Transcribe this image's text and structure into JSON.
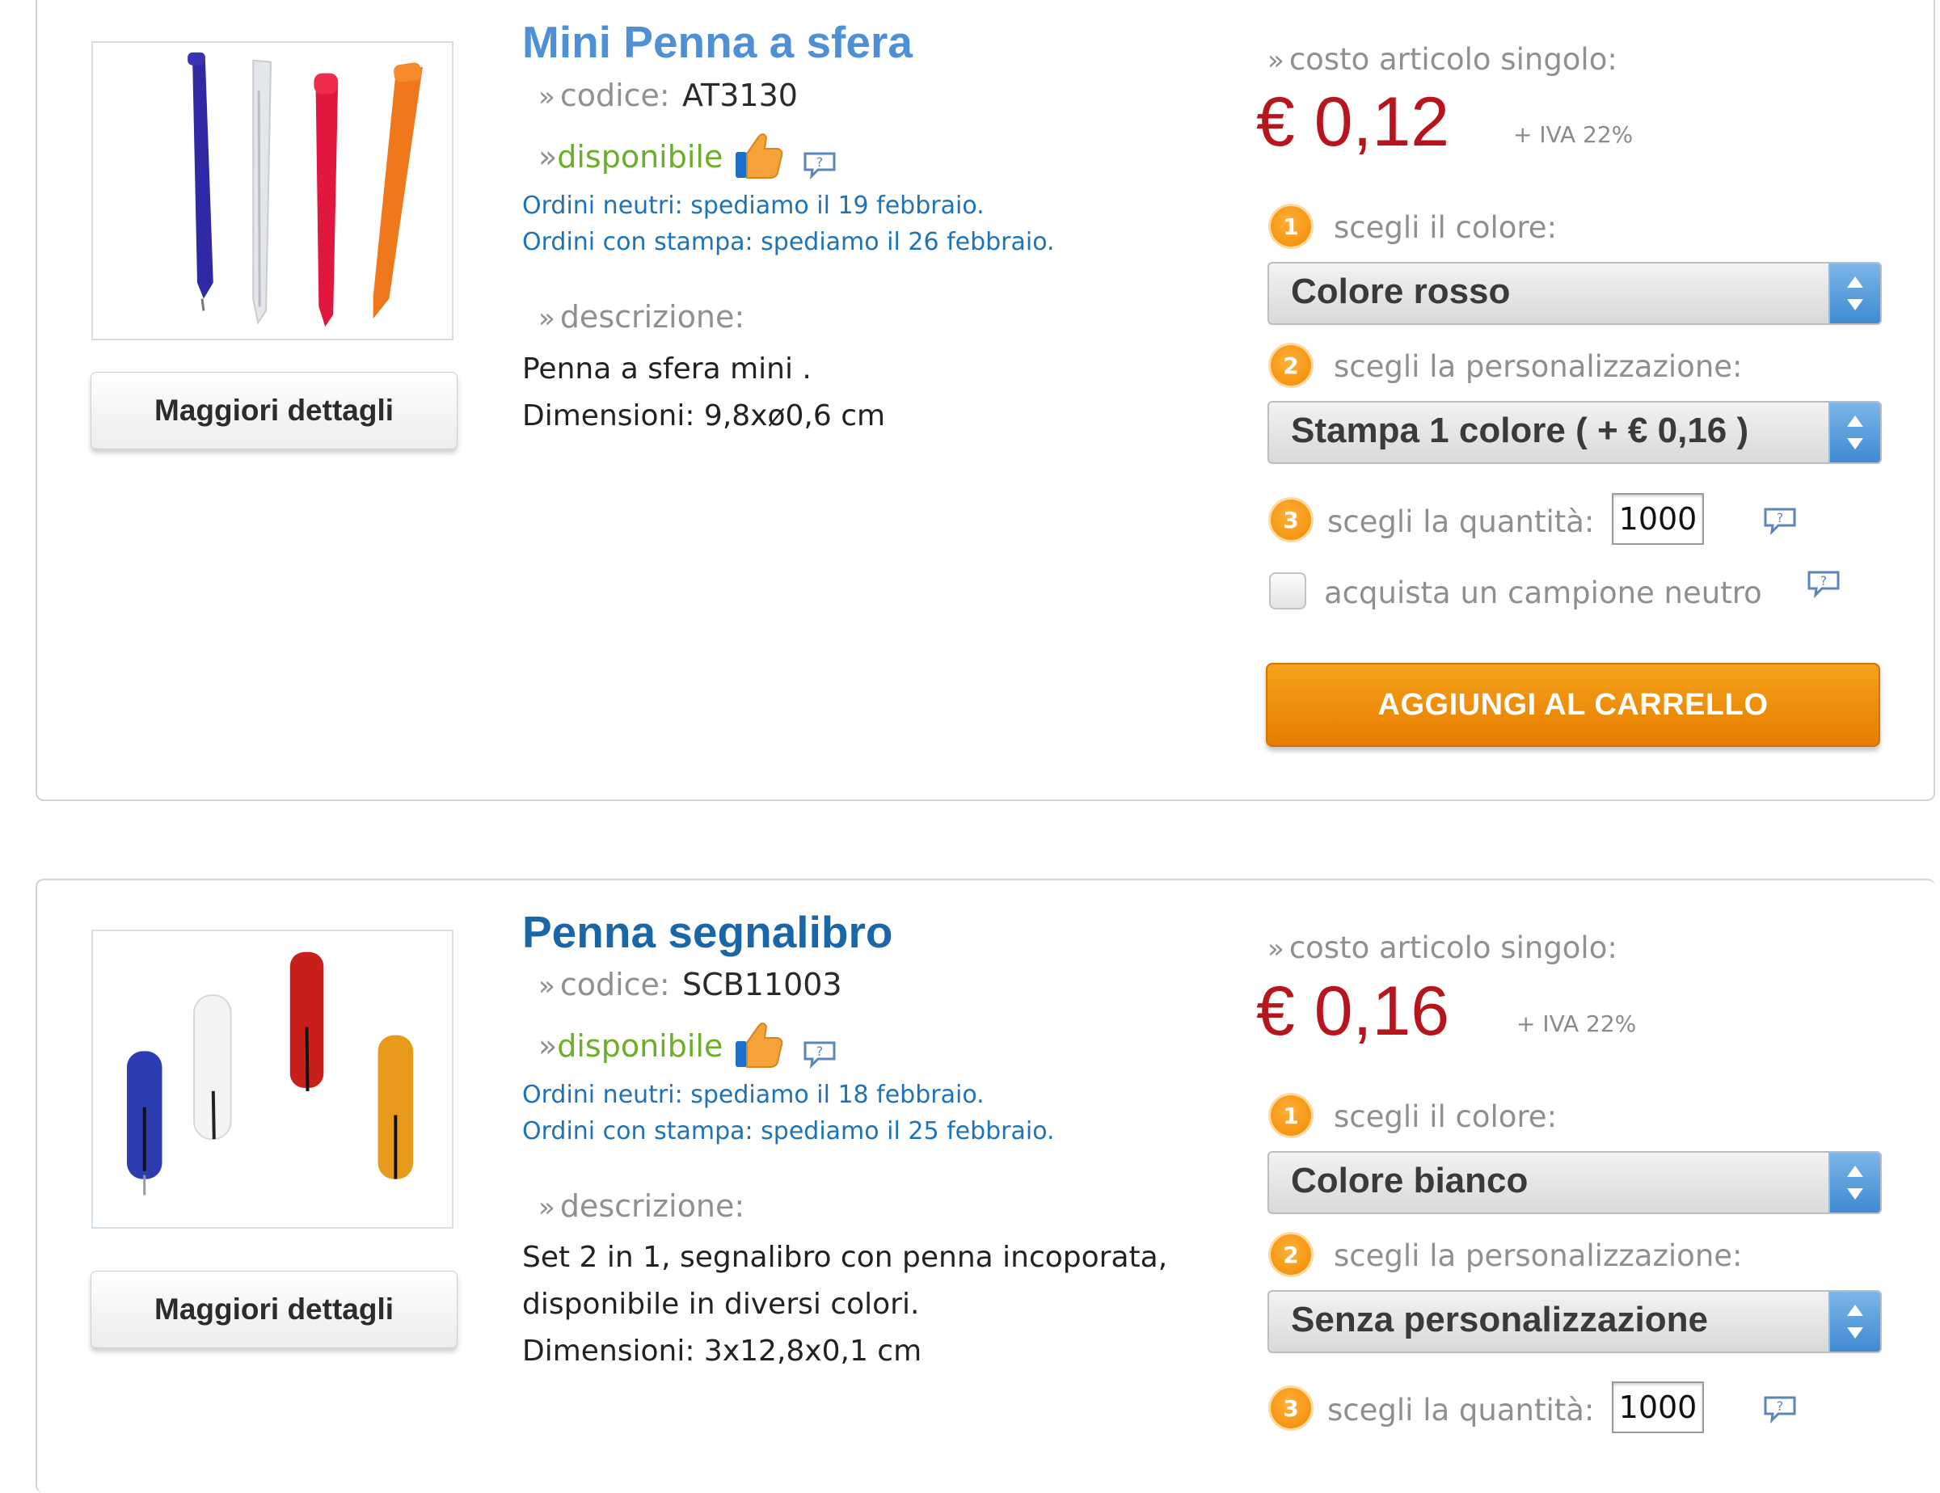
{
  "colors": {
    "title_blue": "#4f8fd6",
    "title_dark_blue": "#1a67a8",
    "price_red": "#b8141c",
    "available_green": "#6cae2a",
    "ship_blue": "#1e73b8",
    "cart_orange": "#f08a00"
  },
  "labels": {
    "code_label": "codice:",
    "available": "disponibile",
    "description_label": "descrizione:",
    "unit_cost_label": "costo articolo singolo:",
    "vat": "+ IVA 22%",
    "step1_label": "scegli il colore:",
    "step2_label": "scegli la personalizzazione:",
    "step3_label": "scegli la quantità:",
    "sample_label": "acquista un campione neutro",
    "details_button": "Maggiori dettagli",
    "cart_button": "AGGIUNGI AL CARRELLO",
    "step1": "1",
    "step2": "2",
    "step3": "3",
    "bullet": "»"
  },
  "products": [
    {
      "title": "Mini Penna a sfera",
      "code": "AT3130",
      "ship_neutral": "Ordini neutri: spediamo il 19 febbraio.",
      "ship_print": "Ordini con stampa: spediamo il 26 febbraio.",
      "desc_line1": "Penna a sfera mini .",
      "desc_line2": "Dimensioni: 9,8xø0,6 cm",
      "price": "€ 0,12",
      "color_selected": "Colore rosso",
      "custom_selected": "Stampa 1 colore ( + € 0,16 )",
      "quantity": "1000",
      "image_icon": "mini-pens-image"
    },
    {
      "title": "Penna segnalibro",
      "code": "SCB11003",
      "ship_neutral": "Ordini neutri: spediamo il 18 febbraio.",
      "ship_print": "Ordini con stampa: spediamo il 25 febbraio.",
      "desc_line1": "Set 2 in 1, segnalibro con penna incoporata,",
      "desc_line2": "disponibile in diversi colori.",
      "desc_line3": "Dimensioni: 3x12,8x0,1 cm",
      "price": "€ 0,16",
      "color_selected": "Colore bianco",
      "custom_selected": "Senza personalizzazione",
      "quantity": "1000",
      "image_icon": "bookmark-pens-image"
    }
  ]
}
